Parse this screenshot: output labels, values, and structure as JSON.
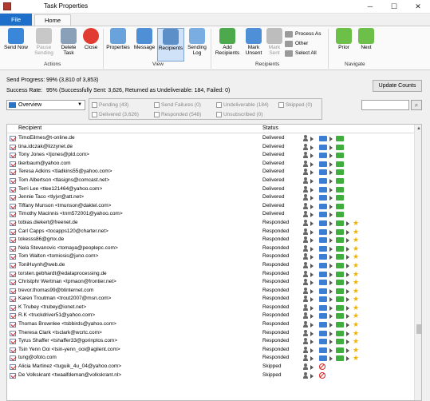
{
  "window": {
    "title": "Task Properties",
    "controls": [
      "─",
      "☐",
      "✕"
    ]
  },
  "tabs": {
    "file": "File",
    "home": "Home"
  },
  "ribbon": {
    "actions": {
      "label": "Actions",
      "send_now": "Send Now",
      "pause_sending": "Pause Sending",
      "delete_task": "Delete Task",
      "close": "Close"
    },
    "view": {
      "label": "View",
      "properties": "Properties",
      "message": "Message",
      "recipients": "Recipients",
      "sending_log": "Sending Log"
    },
    "recipients": {
      "label": "Recipients",
      "add_recipients": "Add Recipients",
      "mark_unsent": "Mark Unsent",
      "mark_sent": "Mark Sent",
      "process_as": "Process As",
      "other": "Other",
      "select_all": "Select All"
    },
    "navigate": {
      "label": "Navigate",
      "prior": "Prior",
      "next": "Next"
    }
  },
  "info": {
    "send_progress_label": "Send Progress:",
    "send_progress_value": "99%  (3,810 of 3,853)",
    "success_rate_label": "Success Rate:",
    "success_rate_value": "95%  (Successfully Sent: 3,626, Returned as Undeliverable: 184, Failed: 0)",
    "update_counts": "Update Counts"
  },
  "filter": {
    "selected": "Overview",
    "options": {
      "pending": "Pending (43)",
      "delivered": "Delivered (3,626)",
      "send_failures": "Send Failures (0)",
      "responded": "Responded (548)",
      "undeliverable": "Undeliverable (184)",
      "unsubscribed": "Unsubscribed (0)",
      "skipped": "Skipped (0)"
    }
  },
  "table": {
    "columns": {
      "recipient": "Recipient",
      "status": "Status"
    },
    "rows": [
      {
        "recipient": "TimoEilmes@t-online.de",
        "status": "Delivered"
      },
      {
        "recipient": "tina.idczak@lizzynet.de",
        "status": "Delivered"
      },
      {
        "recipient": "Tony Jones <tjones@pld.com>",
        "status": "Delivered"
      },
      {
        "recipient": "tkerbaum@yahoo.com",
        "status": "Delivered"
      },
      {
        "recipient": "Teresa Adkins <tladkins55@yahoo.com>",
        "status": "Delivered"
      },
      {
        "recipient": "Tom Albertson <tlasigns@comcast.net>",
        "status": "Delivered"
      },
      {
        "recipient": "Terri Lee <tlee121464@yahoo.com>",
        "status": "Delivered"
      },
      {
        "recipient": "Jennie Taco <tlyjvr@att.net>",
        "status": "Delivered"
      },
      {
        "recipient": "Tiffany Munson <tmunson@daktel.com>",
        "status": "Delivered"
      },
      {
        "recipient": "Timothy Macinnis <tnm572001@yahoo.com>",
        "status": "Delivered"
      },
      {
        "recipient": "tobias.diekert@freenet.de",
        "status": "Responded"
      },
      {
        "recipient": "Carl Capps <tocapps120@charter.net>",
        "status": "Responded"
      },
      {
        "recipient": "tokesss86@gmx.de",
        "status": "Responded"
      },
      {
        "recipient": "Nela Stevanovic <tomaya@peoplepc.com>",
        "status": "Responded"
      },
      {
        "recipient": "Tom Walton <tomiosis@juno.com>",
        "status": "Responded"
      },
      {
        "recipient": "ToniHuynh@web.de",
        "status": "Responded"
      },
      {
        "recipient": "torsten.gebhardt@edataprocessing.de",
        "status": "Responded"
      },
      {
        "recipient": "Christphr Wertman <tpmaon@frontier.net>",
        "status": "Responded"
      },
      {
        "recipient": "trevor.thomas99@btinternet.com",
        "status": "Responded"
      },
      {
        "recipient": "Karen Troutman <trout2007@msn.com>",
        "status": "Responded"
      },
      {
        "recipient": "K Trubey <trubey@ionet.net>",
        "status": "Responded"
      },
      {
        "recipient": "R.K <truckdriver51@yahoo.com>",
        "status": "Responded"
      },
      {
        "recipient": "Thomas Brownlee <tsbbirds@yahoo.com>",
        "status": "Responded"
      },
      {
        "recipient": "Theresa Clark <tsclark@wcrtc.com>",
        "status": "Responded"
      },
      {
        "recipient": "Tyrus Shaffer <tshaffer33@gorinptos.com>",
        "status": "Responded"
      },
      {
        "recipient": "Tsin Yenn Ooi <tsin-yenn_ooi@agilent.com>",
        "status": "Responded"
      },
      {
        "recipient": "tung@ofoto.com",
        "status": "Responded"
      },
      {
        "recipient": "Alicia Martinez <tuguik_4u_04@yahoo.com>",
        "status": "Skipped"
      },
      {
        "recipient": "De Volkskrant <twaalfdeman@volkskrant.nl>",
        "status": "Skipped"
      }
    ]
  },
  "colors": {
    "file_tab": "#1e6fc9",
    "accent_selected": "#cfe2f7",
    "delivered_icon": "#3fae3f",
    "envelope": "#3b7fd4",
    "star": "#f0b400",
    "skipped_icon": "#d22222"
  }
}
